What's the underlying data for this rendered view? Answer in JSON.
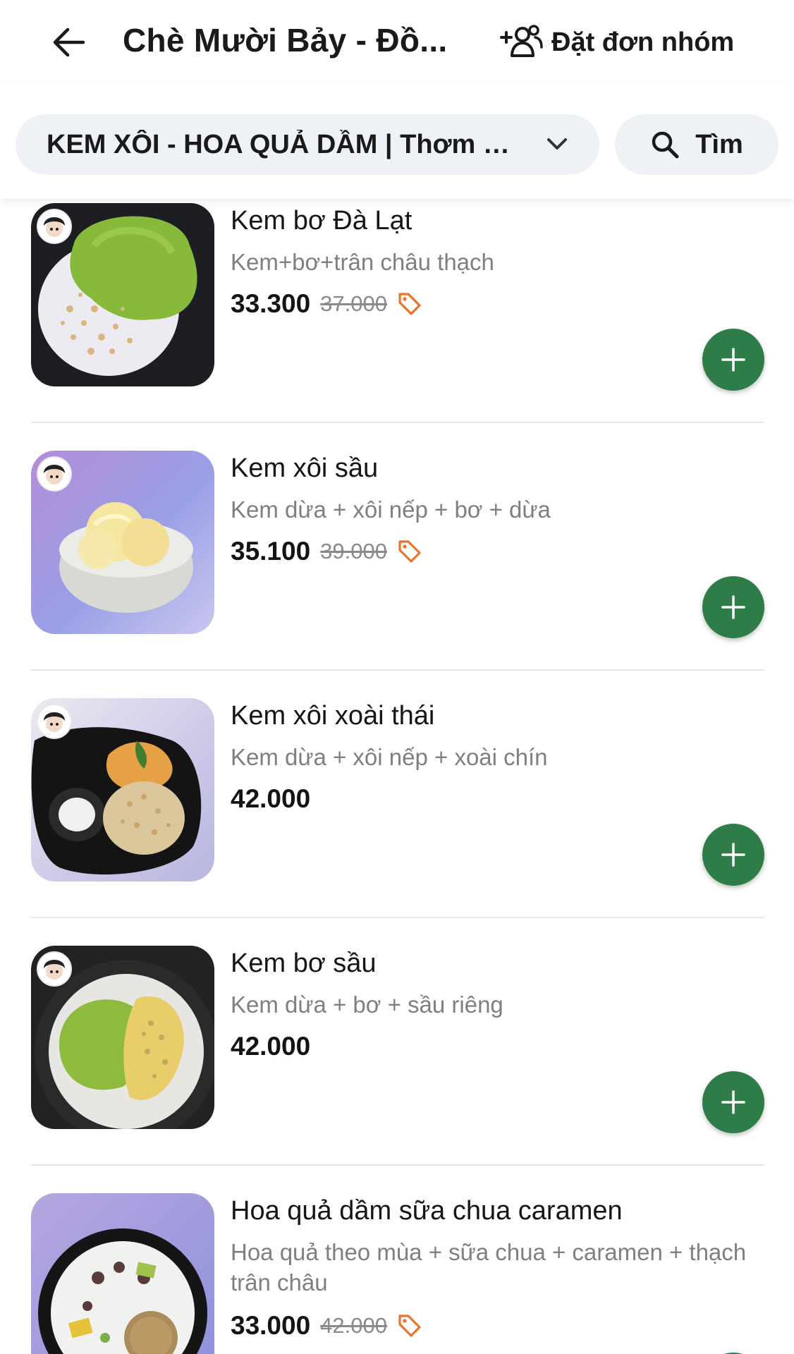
{
  "header": {
    "title": "Chè Mười Bảy - Đồ...",
    "group_order_label": "Đặt đơn nhóm"
  },
  "filter": {
    "category": "KEM XÔI - HOA QUẢ DẦM | Thơm M...",
    "search_label": "Tìm"
  },
  "items": [
    {
      "name": "Kem bơ Đà Lạt",
      "description": "Kem+bơ+trân châu thạch",
      "price": "33.300",
      "old_price": "37.000",
      "promo": true
    },
    {
      "name": "Kem xôi sầu",
      "description": "Kem dừa + xôi nếp + bơ + dừa",
      "price": "35.100",
      "old_price": "39.000",
      "promo": true
    },
    {
      "name": "Kem xôi xoài thái",
      "description": "Kem dừa + xôi nếp + xoài chín",
      "price": "42.000",
      "old_price": "",
      "promo": false
    },
    {
      "name": "Kem bơ sầu",
      "description": "Kem dừa + bơ + sầu riêng",
      "price": "42.000",
      "old_price": "",
      "promo": false
    },
    {
      "name": "Hoa quả dầm sữa chua caramen",
      "description": "Hoa quả theo mùa + sữa chua + caramen + thạch trân châu",
      "price": "33.000",
      "old_price": "42.000",
      "promo": true
    }
  ],
  "colors": {
    "accent_green": "#2e7d48",
    "promo_orange": "#e8742a",
    "chip_background": "#eef2f6"
  },
  "icons": {
    "back": "arrow-left-icon",
    "group": "group-add-icon",
    "dropdown": "chevron-down-icon",
    "search": "search-icon",
    "tag": "price-tag-icon",
    "add": "plus-icon"
  }
}
